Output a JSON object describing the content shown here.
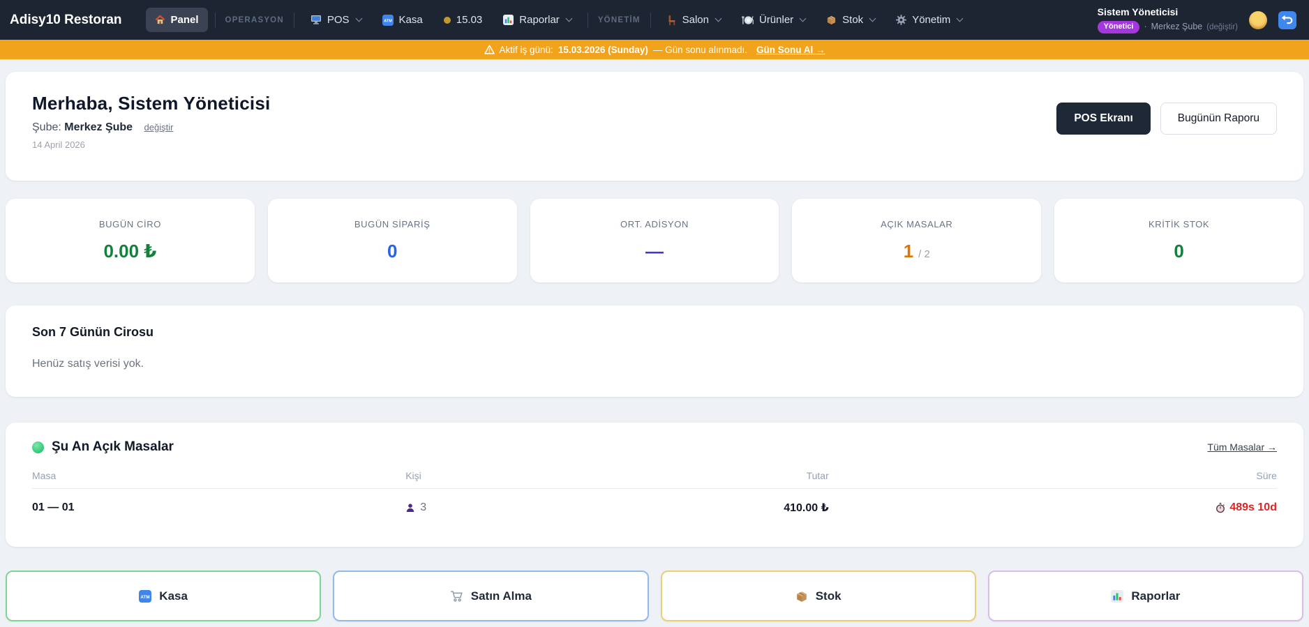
{
  "brand": "Adisy10 Restoran",
  "nav": {
    "section_labels": {
      "operasyon": "OPERASYON",
      "yonetim": "YÖNETİM"
    },
    "items": [
      {
        "label": "Panel"
      },
      {
        "label": "POS"
      },
      {
        "label": "Kasa"
      },
      {
        "label": "15.03"
      },
      {
        "label": "Raporlar"
      },
      {
        "label": "Salon"
      },
      {
        "label": "Ürünler"
      },
      {
        "label": "Stok"
      },
      {
        "label": "Yönetim"
      }
    ],
    "user": {
      "name": "Sistem Yöneticisi",
      "role_badge": "Yönetici",
      "separator": "·",
      "branch": "Merkez Şube",
      "change_label": "(değiştir)"
    }
  },
  "banner": {
    "prefix": "Aktif iş günü:",
    "date": "15.03.2026 (Sunday)",
    "suffix": "— Gün sonu alınmadı.",
    "link_label": "Gün Sonu Al →"
  },
  "welcome": {
    "title": "Merhaba, Sistem Yöneticisi",
    "branch_label": "Şube:",
    "branch": "Merkez Şube",
    "change_link": "değiştir",
    "date": "14 April 2026",
    "primary_button": "POS Ekranı",
    "secondary_button": "Bugünün Raporu"
  },
  "stats": [
    {
      "label": "BUGÜN CİRO",
      "value": "0.00 ₺",
      "color": "#15803d"
    },
    {
      "label": "BUGÜN SİPARİŞ",
      "value": "0",
      "color": "#2563eb"
    },
    {
      "label": "ORT. ADİSYON",
      "value": "—",
      "color": "#4338ca"
    },
    {
      "label": "AÇIK MASALAR",
      "value": "1",
      "suffix": "/ 2",
      "color": "#d97706"
    },
    {
      "label": "KRİTİK STOK",
      "value": "0",
      "color": "#15803d"
    }
  ],
  "chart_section": {
    "title": "Son 7 Günün Cirosu",
    "empty_text": "Henüz satış verisi yok."
  },
  "open_tables": {
    "title": "Şu An Açık Masalar",
    "link_label": "Tüm Masalar →",
    "columns": {
      "masa": "Masa",
      "kisi": "Kişi",
      "tutar": "Tutar",
      "sure": "Süre"
    },
    "rows": [
      {
        "masa": "01 — 01",
        "kisi": "3",
        "tutar": "410.00 ₺",
        "sure": "489s 10d"
      }
    ]
  },
  "quick_actions": [
    {
      "label": "Kasa",
      "border_color": "#7ed694"
    },
    {
      "label": "Satın Alma",
      "border_color": "#8fb9ef"
    },
    {
      "label": "Stok",
      "border_color": "#e9ce72"
    },
    {
      "label": "Raporlar",
      "border_color": "#d8bce9"
    }
  ],
  "colors": {
    "navbar_bg": "#1d2432",
    "banner_bg": "#f2a31c",
    "badge_purple": "#a438dd",
    "accent_green": "#15803d",
    "accent_blue": "#2563eb",
    "accent_indigo": "#4338ca",
    "accent_orange": "#d97706",
    "danger_red": "#dc2626",
    "page_bg": "#eef1f5"
  }
}
